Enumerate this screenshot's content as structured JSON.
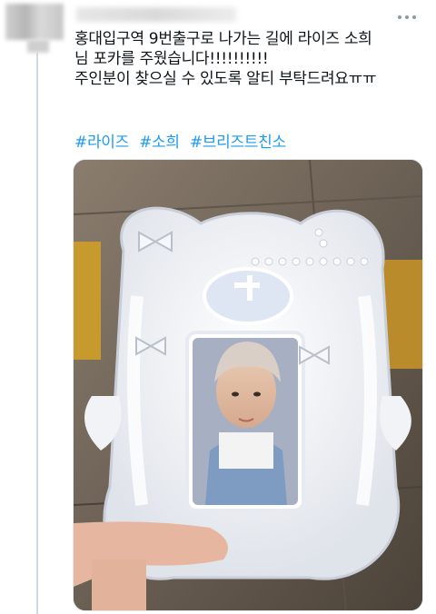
{
  "tweet": {
    "lines": [
      "홍대입구역 9번출구로 나가는 길에 라이즈 소희",
      "님 포카를 주웠습니다!!!!!!!!!!",
      "주인분이 찾으실 수 있도록 알티 부탁드려요ㅠㅠ"
    ],
    "hashtags": [
      "#라이즈",
      "#소희",
      "#브리즈트친소"
    ]
  },
  "icons": {
    "more": "more-dots-icon"
  },
  "colors": {
    "hashtag": "#1d9bf0",
    "text": "#0f1419",
    "thread_line": "#cfd9de"
  }
}
